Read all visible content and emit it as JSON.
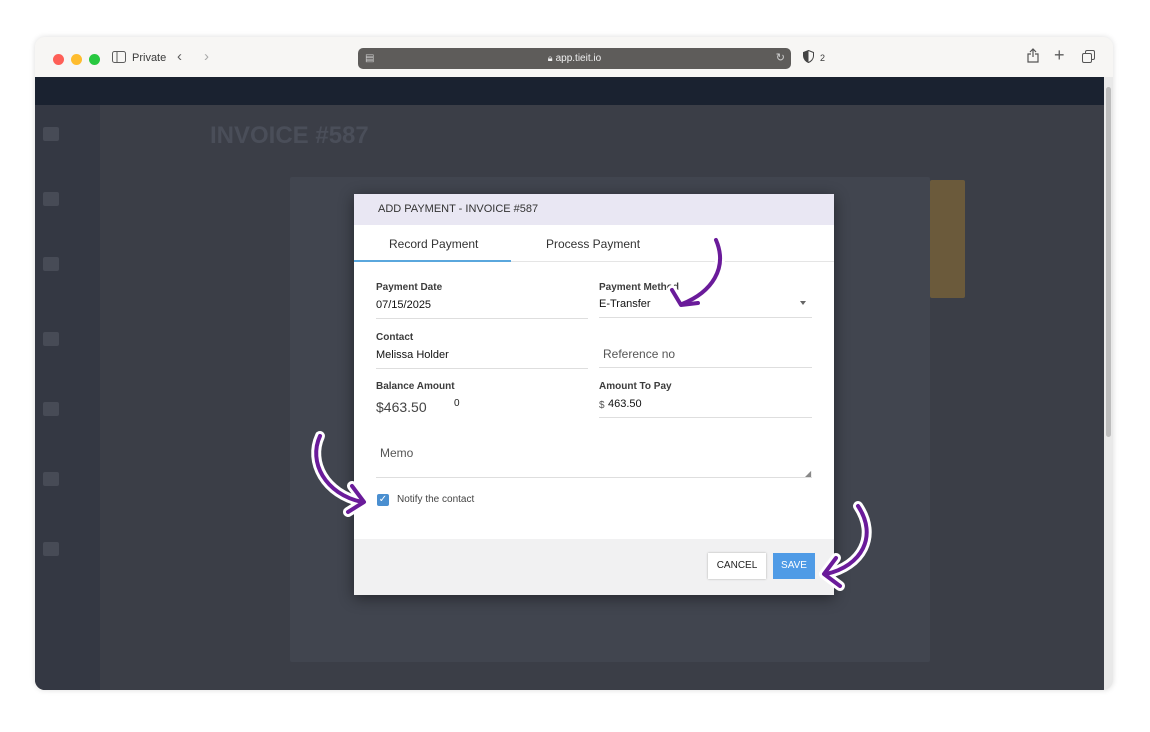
{
  "browser": {
    "mode_label": "Private",
    "url": "app.tieit.io",
    "shield_count": "2"
  },
  "background_page": {
    "title": "INVOICE #587"
  },
  "dialog": {
    "title": "ADD PAYMENT - INVOICE #587",
    "tabs": [
      {
        "label": "Record Payment",
        "active": true
      },
      {
        "label": "Process Payment",
        "active": false
      }
    ],
    "payment_date": {
      "label": "Payment Date",
      "value": "07/15/2025"
    },
    "payment_method": {
      "label": "Payment Method",
      "value": "E-Transfer"
    },
    "contact": {
      "label": "Contact",
      "value": "Melissa Holder"
    },
    "reference": {
      "placeholder": "Reference no"
    },
    "balance": {
      "label": "Balance Amount",
      "value": "$463.50",
      "extra": "0"
    },
    "amount_to_pay": {
      "label": "Amount To Pay",
      "currency": "$",
      "value": "463.50"
    },
    "memo": {
      "placeholder": "Memo"
    },
    "notify": {
      "label": "Notify the contact",
      "checked": true
    },
    "buttons": {
      "cancel": "CANCEL",
      "save": "SAVE"
    }
  },
  "colors": {
    "accent": "#4f9be6",
    "annotation_arrow": "#6a1b9a",
    "dialog_header": "#e9e7f3",
    "overlay": "#3b3e47"
  },
  "icons": [
    "sidebar-icon",
    "back-chevron-icon",
    "forward-chevron-icon",
    "lock-icon",
    "reload-icon",
    "shield-icon",
    "share-icon",
    "new-tab-icon",
    "tabs-icon",
    "dropdown-caret-icon",
    "checkmark-icon",
    "annotation-arrow-icon"
  ]
}
